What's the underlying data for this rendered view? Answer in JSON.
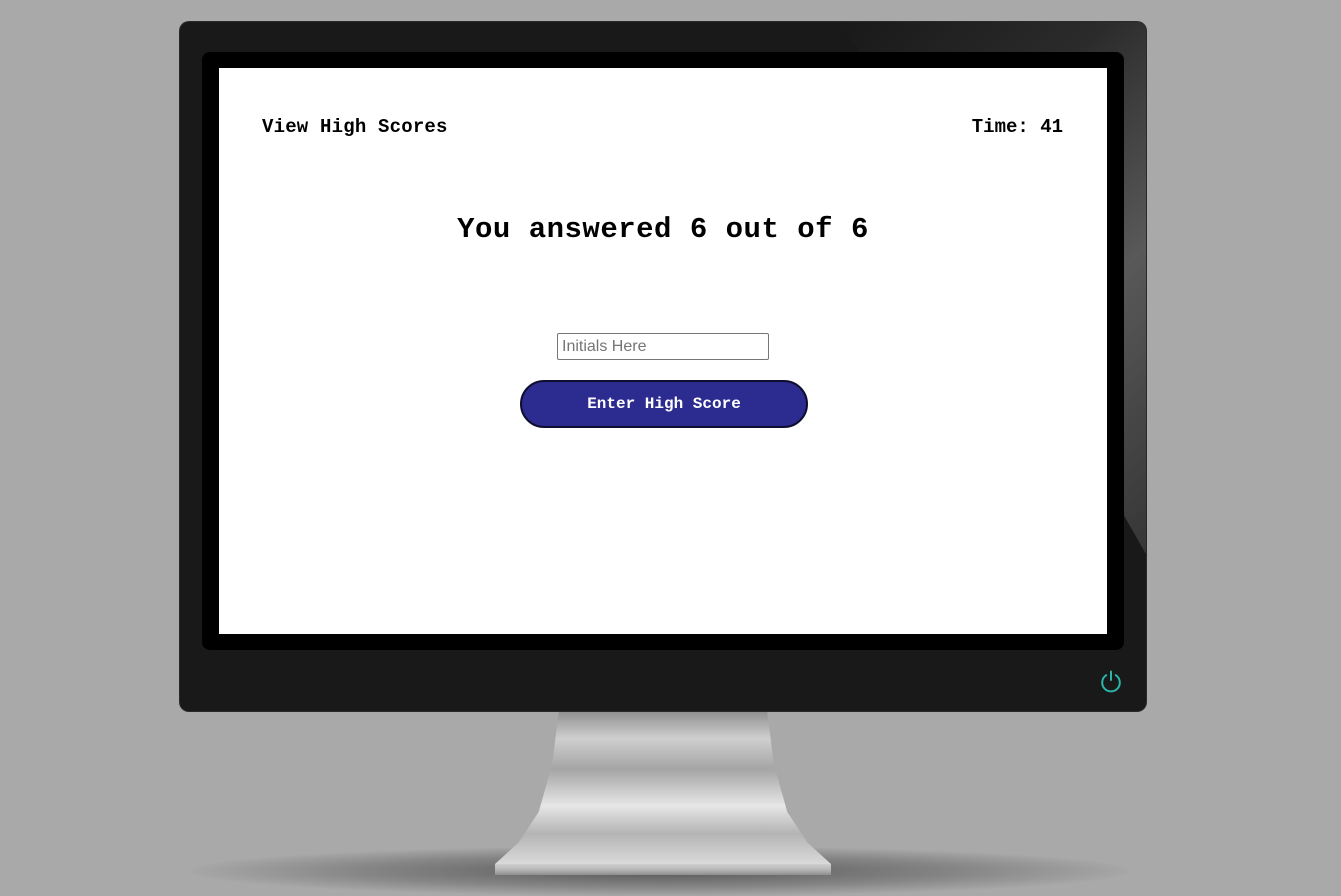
{
  "header": {
    "view_high_scores_label": "View High Scores",
    "timer_text": "Time: 41"
  },
  "result": {
    "message": "You answered 6 out of 6"
  },
  "form": {
    "initials_placeholder": "Initials Here",
    "initials_value": "",
    "submit_label": "Enter High Score"
  },
  "icons": {
    "power": "power-icon"
  },
  "colors": {
    "button_background": "#2c2b8f",
    "button_text": "#ffffff",
    "power_icon": "#29b6a8",
    "screen_background": "#ffffff",
    "page_background": "#a9a9a9"
  }
}
